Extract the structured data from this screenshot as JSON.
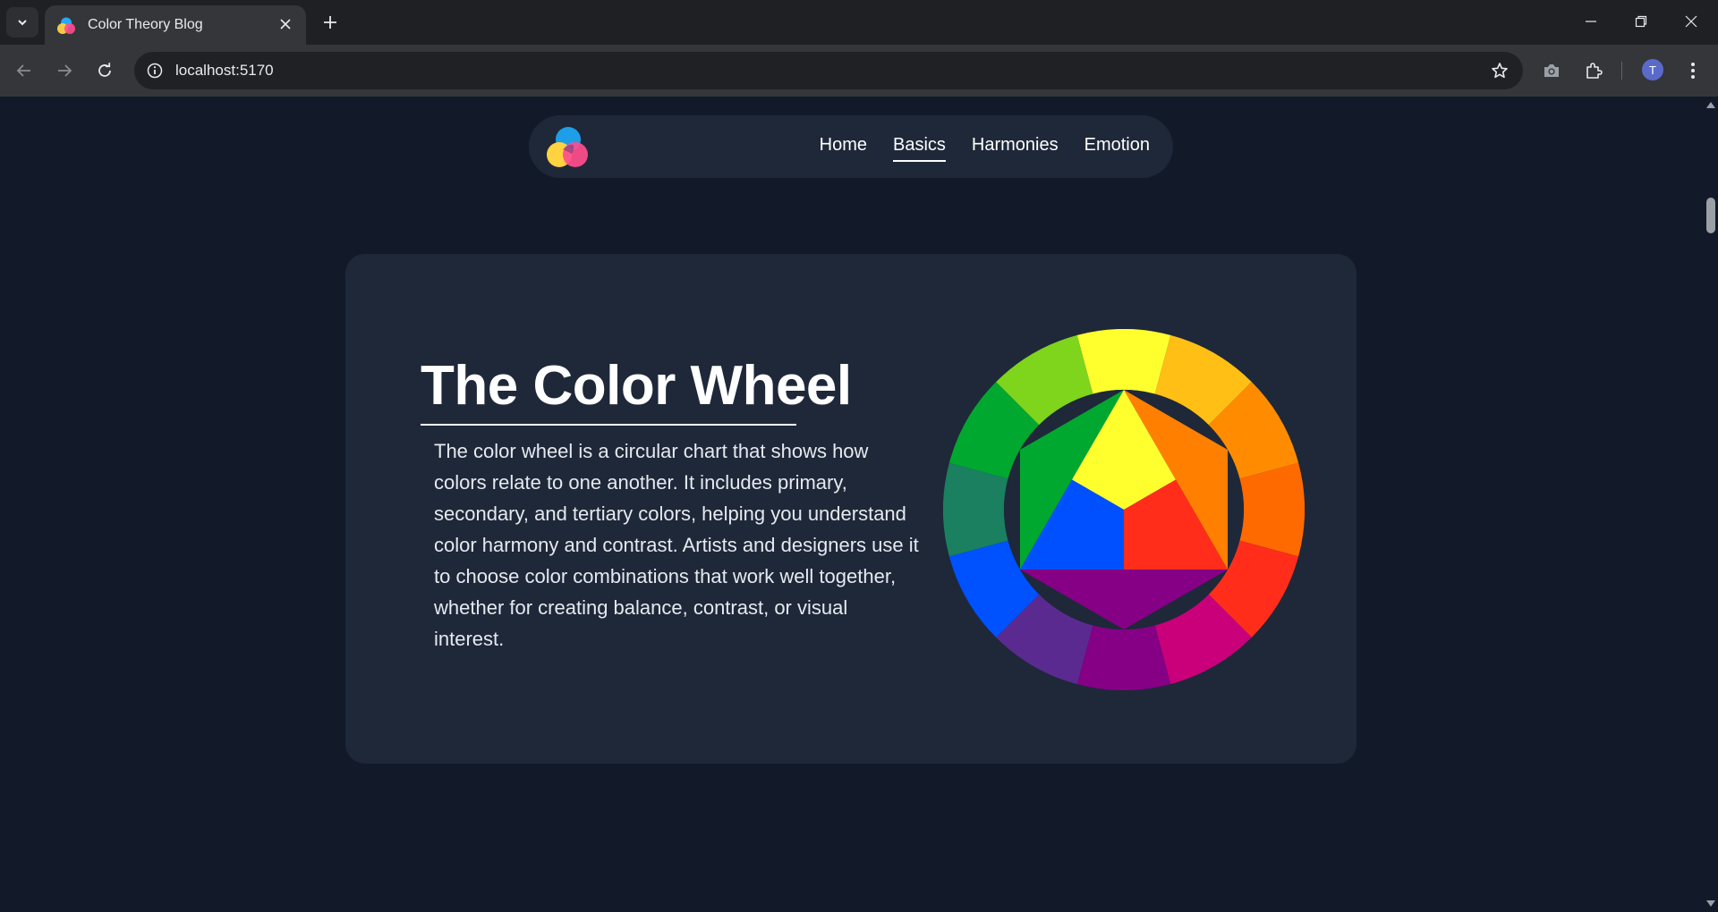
{
  "browser": {
    "tab_title": "Color Theory Blog",
    "url": "localhost:5170",
    "profile_initial": "T"
  },
  "site": {
    "nav": [
      {
        "label": "Home",
        "active": false
      },
      {
        "label": "Basics",
        "active": true
      },
      {
        "label": "Harmonies",
        "active": false
      },
      {
        "label": "Emotion",
        "active": false
      }
    ]
  },
  "hero": {
    "title": "The Color Wheel",
    "body": "The color wheel is a circular chart that shows how colors relate to one another. It includes primary, secondary, and tertiary colors, helping you understand color harmony and contrast. Artists and designers use it to choose color combinations that work well together, whether for creating balance, contrast, or visual interest."
  },
  "colors": {
    "page_bg": "#121a2a",
    "card_bg": "#1e2839",
    "ring": [
      "#ffff2e",
      "#ffbf14",
      "#ff8c00",
      "#ff6a00",
      "#ff2d1a",
      "#c9007a",
      "#850085",
      "#5b2a91",
      "#0051ff",
      "#1a8060",
      "#00a830",
      "#7fd41c"
    ],
    "triangle": {
      "yellow": "#ffff2e",
      "red": "#ff2d1a",
      "blue": "#0050ff"
    },
    "secondary": {
      "orange": "#ff7f00",
      "purple": "#850085",
      "green": "#00a830"
    }
  }
}
